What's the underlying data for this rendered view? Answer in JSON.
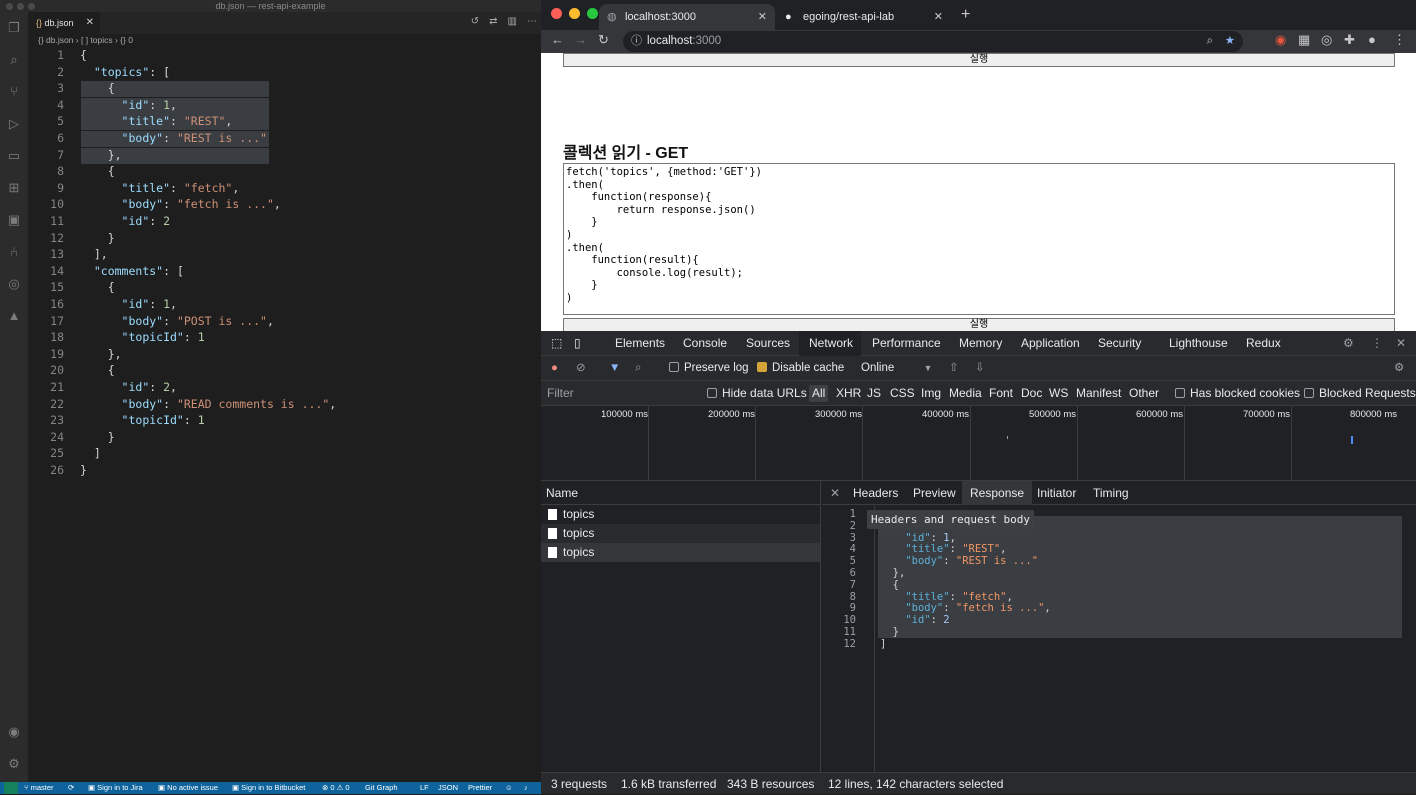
{
  "vscode": {
    "window_title": "db.json — rest-api-example",
    "tab_label": "db.json",
    "breadcrumb": "{} db.json › [ ] topics › {} 0",
    "code_lines": [
      {
        "n": "1",
        "t": "{"
      },
      {
        "n": "2",
        "t": "  \"topics\": ["
      },
      {
        "n": "3",
        "t": "    {"
      },
      {
        "n": "4",
        "t": "      \"id\": 1,"
      },
      {
        "n": "5",
        "t": "      \"title\": \"REST\","
      },
      {
        "n": "6",
        "t": "      \"body\": \"REST is ...\""
      },
      {
        "n": "7",
        "t": "    },"
      },
      {
        "n": "8",
        "t": "    {"
      },
      {
        "n": "9",
        "t": "      \"title\": \"fetch\","
      },
      {
        "n": "10",
        "t": "      \"body\": \"fetch is ...\","
      },
      {
        "n": "11",
        "t": "      \"id\": 2"
      },
      {
        "n": "12",
        "t": "    }"
      },
      {
        "n": "13",
        "t": "  ],"
      },
      {
        "n": "14",
        "t": "  \"comments\": ["
      },
      {
        "n": "15",
        "t": "    {"
      },
      {
        "n": "16",
        "t": "      \"id\": 1,"
      },
      {
        "n": "17",
        "t": "      \"body\": \"POST is ...\","
      },
      {
        "n": "18",
        "t": "      \"topicId\": 1"
      },
      {
        "n": "19",
        "t": "    },"
      },
      {
        "n": "20",
        "t": "    {"
      },
      {
        "n": "21",
        "t": "      \"id\": 2,"
      },
      {
        "n": "22",
        "t": "      \"body\": \"READ comments is ...\","
      },
      {
        "n": "23",
        "t": "      \"topicId\": 1"
      },
      {
        "n": "24",
        "t": "    }"
      },
      {
        "n": "25",
        "t": "  ]"
      },
      {
        "n": "26",
        "t": "}"
      }
    ],
    "status": {
      "branch": "master",
      "jira": "Sign in to Jira",
      "issue": "No active issue",
      "bitbucket": "Sign in to Bitbucket",
      "problems": "⊗ 0 ⚠ 0",
      "git_graph": "Git Graph",
      "eol": "LF",
      "lang": "JSON",
      "prettier": "Prettier"
    }
  },
  "browser": {
    "tabs": [
      {
        "label": "localhost:3000"
      },
      {
        "label": "egoing/rest-api-lab"
      }
    ],
    "url_host": "localhost",
    "url_port": ":3000",
    "page": {
      "run_button_top": "실행",
      "section_title": "콜렉션 읽기 - GET",
      "code": "fetch('topics', {method:'GET'})\n.then(\n    function(response){\n        return response.json()\n    }\n)\n.then(\n    function(result){\n        console.log(result);\n    }\n)",
      "run_button": "실행"
    },
    "devtools": {
      "tabs": [
        "Elements",
        "Console",
        "Sources",
        "Network",
        "Performance",
        "Memory",
        "Application",
        "Security",
        "Lighthouse",
        "Redux"
      ],
      "active_tab": "Network",
      "preserve_log": "Preserve log",
      "disable_cache": "Disable cache",
      "throttle": "Online",
      "filter_placeholder": "Filter",
      "hide_data_urls": "Hide data URLs",
      "types": [
        "All",
        "XHR",
        "JS",
        "CSS",
        "Img",
        "Media",
        "Font",
        "Doc",
        "WS",
        "Manifest",
        "Other"
      ],
      "has_blocked_cookies": "Has blocked cookies",
      "blocked_requests": "Blocked Requests",
      "ticks": [
        "100000 ms",
        "200000 ms",
        "300000 ms",
        "400000 ms",
        "500000 ms",
        "600000 ms",
        "700000 ms",
        "800000 ms"
      ],
      "name_header": "Name",
      "requests": [
        "topics",
        "topics",
        "topics"
      ],
      "detail_tabs": [
        "Headers",
        "Preview",
        "Response",
        "Initiator",
        "Timing"
      ],
      "active_detail": "Response",
      "tooltip": "Headers and request body",
      "response_lines": [
        {
          "n": "1",
          "t": ""
        },
        {
          "n": "2",
          "t": ""
        },
        {
          "n": "3",
          "t": "    \"id\": 1,"
        },
        {
          "n": "4",
          "t": "    \"title\": \"REST\","
        },
        {
          "n": "5",
          "t": "    \"body\": \"REST is ...\""
        },
        {
          "n": "6",
          "t": "  },"
        },
        {
          "n": "7",
          "t": "  {"
        },
        {
          "n": "8",
          "t": "    \"title\": \"fetch\","
        },
        {
          "n": "9",
          "t": "    \"body\": \"fetch is ...\","
        },
        {
          "n": "10",
          "t": "    \"id\": 2"
        },
        {
          "n": "11",
          "t": "  }"
        },
        {
          "n": "12",
          "t": "]"
        }
      ],
      "status": {
        "requests": "3 requests",
        "transferred": "1.6 kB transferred",
        "resources": "343 B resources",
        "selection": "12 lines, 142 characters selected"
      }
    }
  }
}
